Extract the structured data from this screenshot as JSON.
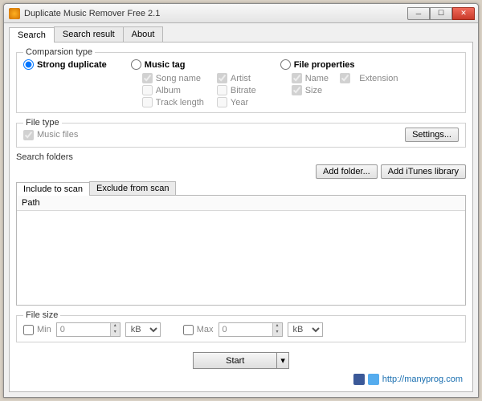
{
  "window": {
    "title": "Duplicate Music Remover Free 2.1"
  },
  "tabs": {
    "search": "Search",
    "result": "Search result",
    "about": "About"
  },
  "comparison": {
    "label": "Comparsion type",
    "strong": "Strong duplicate",
    "tag": "Music tag",
    "props": "File properties",
    "tag_opts": {
      "song": "Song name",
      "artist": "Artist",
      "album": "Album",
      "bitrate": "Bitrate",
      "track": "Track length",
      "year": "Year"
    },
    "prop_opts": {
      "name": "Name",
      "ext": "Extension",
      "size": "Size"
    }
  },
  "filetype": {
    "label": "File type",
    "music": "Music files",
    "settings": "Settings..."
  },
  "folders": {
    "label": "Search folders",
    "add": "Add folder...",
    "add_itunes": "Add iTunes library",
    "include": "Include to scan",
    "exclude": "Exclude from scan",
    "path_col": "Path"
  },
  "filesize": {
    "label": "File size",
    "min": "Min",
    "max": "Max",
    "min_val": "0",
    "max_val": "0",
    "unit": "kB"
  },
  "start": "Start",
  "footer": {
    "url": "http://manyprog.com"
  }
}
